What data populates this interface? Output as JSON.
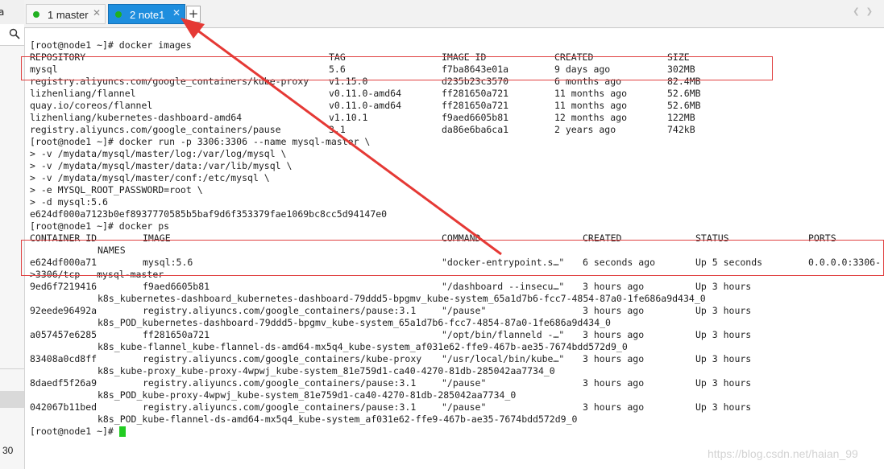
{
  "sidebar": {
    "top_glyph": "a",
    "bottom_number": "30"
  },
  "tabs": [
    {
      "label": "1 master",
      "active": false
    },
    {
      "label": "2 note1",
      "active": true
    }
  ],
  "tab_add_label": "+",
  "colors": {
    "active_tab": "#1e8ede",
    "status_dot": "#20b020",
    "annotation": "#e04040",
    "cursor": "#22cc22"
  },
  "terminal": {
    "prompt_images": "[root@node1 ~]# docker images",
    "images_header": [
      "REPOSITORY",
      "TAG",
      "IMAGE ID",
      "CREATED",
      "SIZE"
    ],
    "images": [
      [
        "mysql",
        "5.6",
        "f7ba8643e01a",
        "9 days ago",
        "302MB"
      ],
      [
        "registry.aliyuncs.com/google_containers/kube-proxy",
        "v1.15.0",
        "d235b23c3570",
        "6 months ago",
        "82.4MB"
      ],
      [
        "lizhenliang/flannel",
        "v0.11.0-amd64",
        "ff281650a721",
        "11 months ago",
        "52.6MB"
      ],
      [
        "quay.io/coreos/flannel",
        "v0.11.0-amd64",
        "ff281650a721",
        "11 months ago",
        "52.6MB"
      ],
      [
        "lizhenliang/kubernetes-dashboard-amd64",
        "v1.10.1",
        "f9aed6605b81",
        "12 months ago",
        "122MB"
      ],
      [
        "registry.aliyuncs.com/google_containers/pause",
        "3.1",
        "da86e6ba6ca1",
        "2 years ago",
        "742kB"
      ]
    ],
    "run_lines": [
      "[root@node1 ~]# docker run -p 3306:3306 --name mysql-master \\",
      "> -v /mydata/mysql/master/log:/var/log/mysql \\",
      "> -v /mydata/mysql/master/data:/var/lib/mysql \\",
      "> -v /mydata/mysql/master/conf:/etc/mysql \\",
      "> -e MYSQL_ROOT_PASSWORD=root \\",
      "> -d mysql:5.6",
      "e624df000a7123b0ef8937770585b5baf9d6f353379fae1069bc8cc5d94147e0",
      "[root@node1 ~]# docker ps"
    ],
    "ps_header": [
      "CONTAINER ID",
      "IMAGE",
      "COMMAND",
      "CREATED",
      "STATUS",
      "PORTS"
    ],
    "ps_header_names": "NAMES",
    "containers": [
      {
        "id": "e624df000a71",
        "image": "mysql:5.6",
        "command": "\"docker-entrypoint.s…\"",
        "created": "6 seconds ago",
        "status": "Up 5 seconds",
        "ports": "0.0.0.0:3306-",
        "names": ">3306/tcp   mysql-master"
      },
      {
        "id": "9ed6f7219416",
        "image": "f9aed6605b81",
        "command": "\"/dashboard --insecu…\"",
        "created": "3 hours ago",
        "status": "Up 3 hours",
        "ports": "",
        "names": "k8s_kubernetes-dashboard_kubernetes-dashboard-79ddd5-bpgmv_kube-system_65a1d7b6-fcc7-4854-87a0-1fe686a9d434_0"
      },
      {
        "id": "92eede96492a",
        "image": "registry.aliyuncs.com/google_containers/pause:3.1",
        "command": "\"/pause\"",
        "created": "3 hours ago",
        "status": "Up 3 hours",
        "ports": "",
        "names": "k8s_POD_kubernetes-dashboard-79ddd5-bpgmv_kube-system_65a1d7b6-fcc7-4854-87a0-1fe686a9d434_0"
      },
      {
        "id": "a057457e6285",
        "image": "ff281650a721",
        "command": "\"/opt/bin/flanneld -…\"",
        "created": "3 hours ago",
        "status": "Up 3 hours",
        "ports": "",
        "names": "k8s_kube-flannel_kube-flannel-ds-amd64-mx5q4_kube-system_af031e62-ffe9-467b-ae35-7674bdd572d9_0"
      },
      {
        "id": "83408a0cd8ff",
        "image": "registry.aliyuncs.com/google_containers/kube-proxy",
        "command": "\"/usr/local/bin/kube…\"",
        "created": "3 hours ago",
        "status": "Up 3 hours",
        "ports": "",
        "names": "k8s_kube-proxy_kube-proxy-4wpwj_kube-system_81e759d1-ca40-4270-81db-285042aa7734_0"
      },
      {
        "id": "8daedf5f26a9",
        "image": "registry.aliyuncs.com/google_containers/pause:3.1",
        "command": "\"/pause\"",
        "created": "3 hours ago",
        "status": "Up 3 hours",
        "ports": "",
        "names": "k8s_POD_kube-proxy-4wpwj_kube-system_81e759d1-ca40-4270-81db-285042aa7734_0"
      },
      {
        "id": "042067b11bed",
        "image": "registry.aliyuncs.com/google_containers/pause:3.1",
        "command": "\"/pause\"",
        "created": "3 hours ago",
        "status": "Up 3 hours",
        "ports": "",
        "names": "k8s_POD_kube-flannel-ds-amd64-mx5q4_kube-system_af031e62-ffe9-467b-ae35-7674bdd572d9_0"
      }
    ],
    "final_prompt": "[root@node1 ~]# "
  },
  "watermark": "https://blog.csdn.net/haian_99"
}
